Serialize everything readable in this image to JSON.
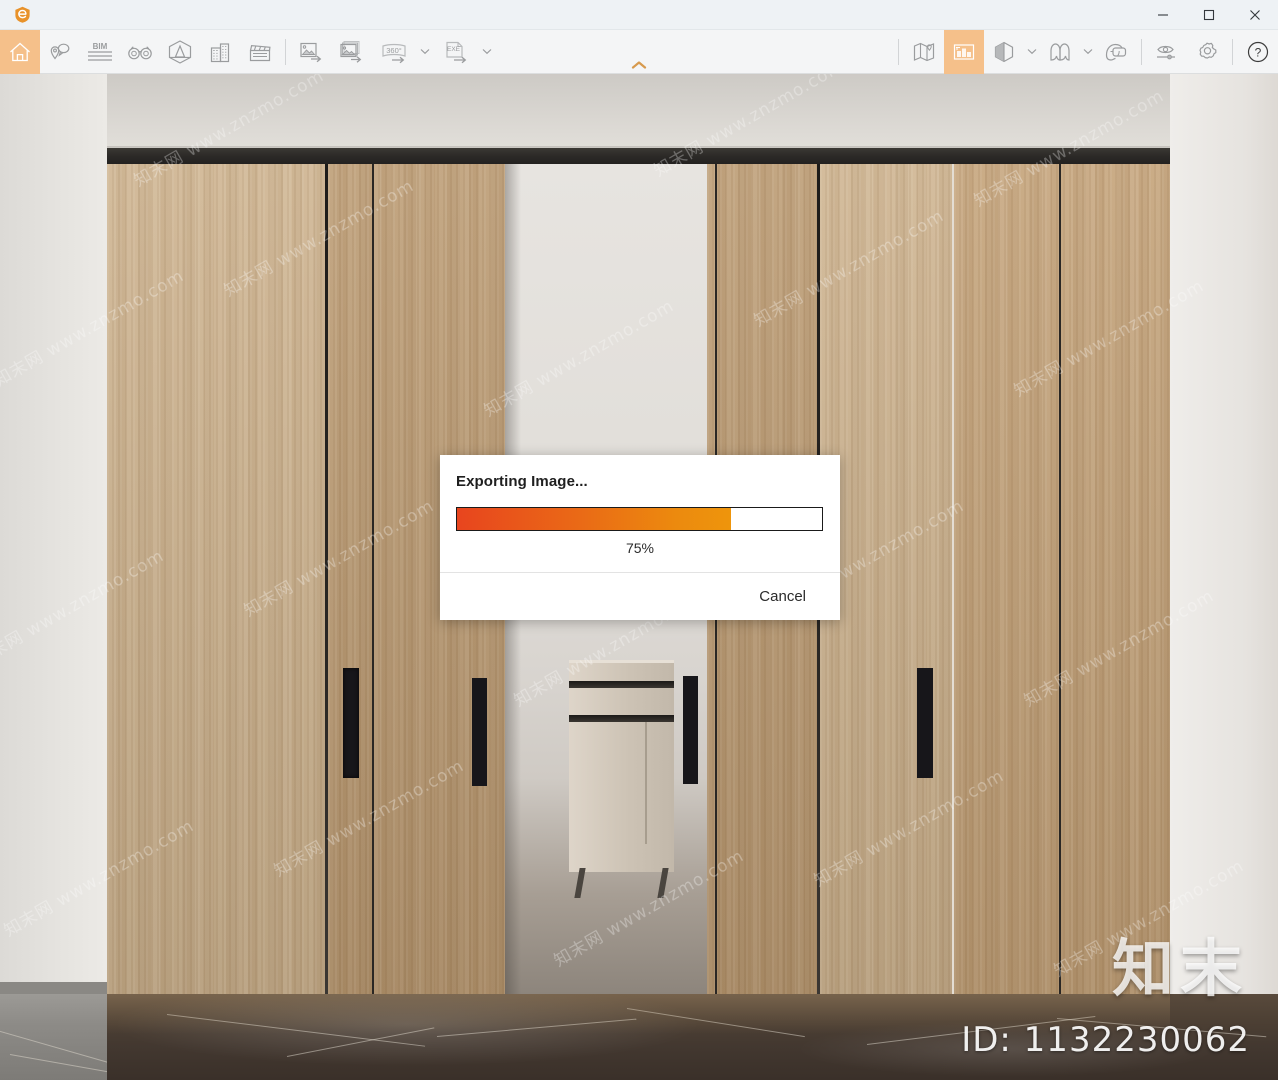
{
  "window": {
    "logo_icon": "app-logo-icon",
    "controls": [
      {
        "name": "minimize",
        "glyph": "─"
      },
      {
        "name": "maximize",
        "glyph": "☐"
      },
      {
        "name": "close",
        "glyph": "✕"
      }
    ]
  },
  "toolbar": {
    "collapse_chevron": "chevron-up-icon",
    "left_group": [
      {
        "id": "home",
        "icon": "home-icon",
        "label": "Home",
        "active": true
      },
      {
        "id": "location",
        "icon": "location-pin-icon",
        "label": "Location"
      },
      {
        "id": "bim",
        "icon": "bim-icon",
        "label": "BIM"
      },
      {
        "id": "roam",
        "icon": "binoculars-icon",
        "label": "Roam"
      },
      {
        "id": "model",
        "icon": "model-cube-icon",
        "label": "Model"
      },
      {
        "id": "building",
        "icon": "building-icon",
        "label": "Building"
      },
      {
        "id": "video",
        "icon": "clapperboard-icon",
        "label": "Video"
      }
    ],
    "export_group": [
      {
        "id": "export-image",
        "icon": "export-image-icon",
        "label": "Export Image"
      },
      {
        "id": "export-batch",
        "icon": "export-batch-icon",
        "label": "Batch Export"
      },
      {
        "id": "export-360",
        "icon": "export-360-icon",
        "label": "360° Panorama",
        "caret": true,
        "badge": "360°"
      },
      {
        "id": "export-exe",
        "icon": "export-exe-icon",
        "label": "EXE",
        "caret": true,
        "badge": "EXE"
      }
    ],
    "right_group": [
      {
        "id": "map",
        "icon": "map-pin-icon",
        "label": "Map"
      },
      {
        "id": "render-view",
        "icon": "render-view-icon",
        "label": "Render View",
        "active": true
      },
      {
        "id": "material",
        "icon": "hexagon-half-icon",
        "label": "Material",
        "caret": true
      },
      {
        "id": "curtain",
        "icon": "arch-icon",
        "label": "Curtain",
        "caret": true
      },
      {
        "id": "vr",
        "icon": "vr-headset-icon",
        "label": "VR"
      },
      {
        "id": "visibility",
        "icon": "eye-slider-icon",
        "label": "Visibility"
      },
      {
        "id": "settings",
        "icon": "gear-icon",
        "label": "Settings"
      },
      {
        "id": "help",
        "icon": "help-circle-icon",
        "label": "Help"
      }
    ]
  },
  "dialog": {
    "title": "Exporting Image...",
    "progress_percent": 75,
    "progress_label": "75%",
    "cancel_label": "Cancel",
    "fill_start_color": "#e8451e",
    "fill_end_color": "#ee950c"
  },
  "watermark": {
    "brand": "知末",
    "id": "ID: 1132230062",
    "tile_text": "知末网 www.znzmo.com"
  }
}
